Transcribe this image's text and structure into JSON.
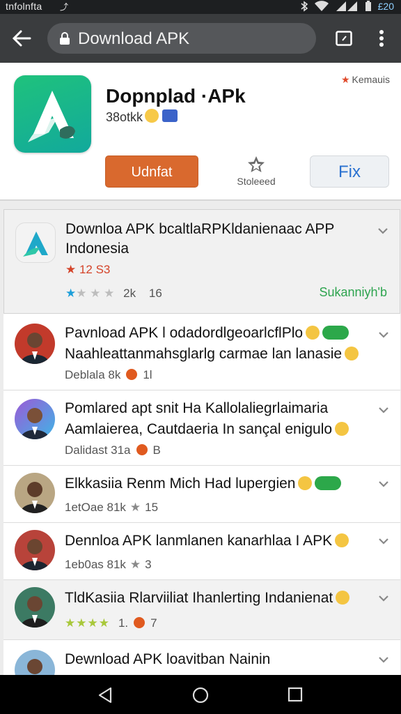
{
  "status_bar": {
    "carrier": "tnfolnfta",
    "battery": "£20"
  },
  "toolbar": {
    "url": "Download APK"
  },
  "app": {
    "title": "Dopnplad ·APk",
    "subtitle": "38otkk",
    "reviews_tag": "Kemauis",
    "install_label": "Udnfat",
    "star_label": "Stoleeed",
    "fix_label": "Fix"
  },
  "items": [
    {
      "line1": "Downloa APK bcaltlaRPKldanienaac APP",
      "line2": "Indonesia",
      "rating_line": "★ 12 S3",
      "meta_a": "2k",
      "meta_b": "16",
      "link": "Sukanniyh'b"
    },
    {
      "line1": "Pavnload APK l odadordlgeoarlcflPlo",
      "line2": "Naahleattanmahsglarlg carmae lan lanasie",
      "meta_a": "Deblala 8k",
      "meta_b": "1l"
    },
    {
      "line1": "Pomlared apt snit Ha Kallolaliegrlaimaria",
      "line2": "Aamlaierea, Cautdaeria In sançal enigulo",
      "meta_a": "Dalidast 31a",
      "meta_b": "B"
    },
    {
      "line1": "Elkkasiia Renm Mich Had lupergien",
      "meta_a": "1etOae 81k",
      "meta_b": "15"
    },
    {
      "line1": "Dennloa APK lanmlanen kanarhlaa I APK",
      "meta_a": "1eb0as 81k",
      "meta_b": "3"
    },
    {
      "line1": "TldKasiia Rlarviiliat Ihanlerting Indanienat",
      "meta_a": "1.",
      "meta_b": "7"
    },
    {
      "line1": "Dewnload APK loavitban Nainin"
    }
  ],
  "colors": {
    "accent_orange": "#d9692e",
    "link_green": "#2ea44f",
    "fix_blue": "#2a71d0"
  }
}
